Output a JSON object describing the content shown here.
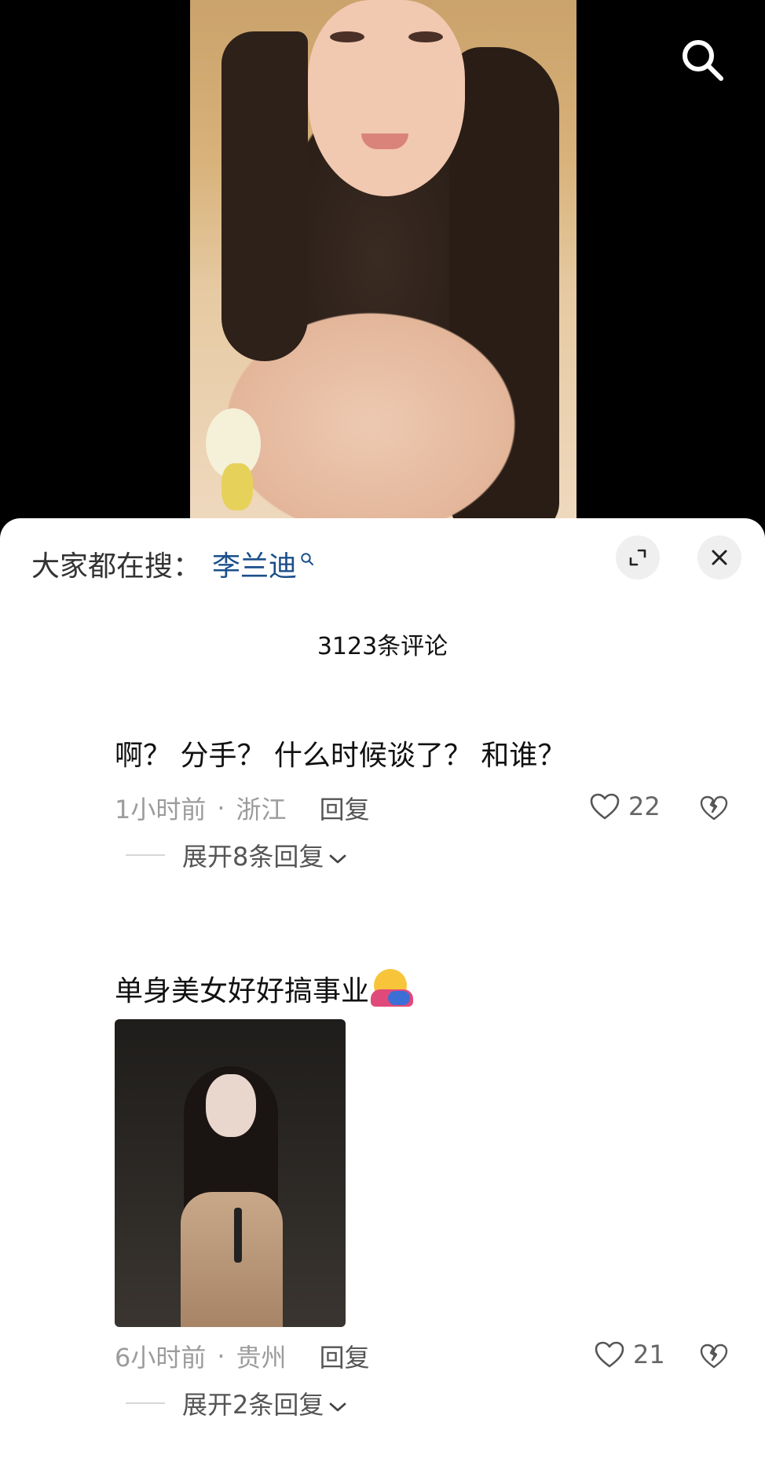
{
  "video": {
    "search_icon": "search-icon"
  },
  "sheet": {
    "trending_prefix": "大家都在搜：",
    "trending_term": "李兰迪",
    "trending_term_icon": "search-small-icon",
    "expand_icon": "expand-icon",
    "close_icon": "close-icon",
    "comment_count_label": "3123条评论"
  },
  "comments": [
    {
      "text": "啊？ 分手？ 什么时候谈了？ 和谁？",
      "time": "1小时前",
      "separator": "·",
      "location": "浙江",
      "reply_label": "回复",
      "likes": "22",
      "expand_label": "展开8条回复"
    },
    {
      "text": "单身美女好好搞事业",
      "emoji": "hugging-face-emoji",
      "time": "6小时前",
      "separator": "·",
      "location": "贵州",
      "reply_label": "回复",
      "likes": "21",
      "expand_label": "展开2条回复"
    }
  ],
  "colors": {
    "link_blue": "#1a4f8b",
    "meta_gray": "#9c9c9c",
    "background_black": "#000000"
  }
}
